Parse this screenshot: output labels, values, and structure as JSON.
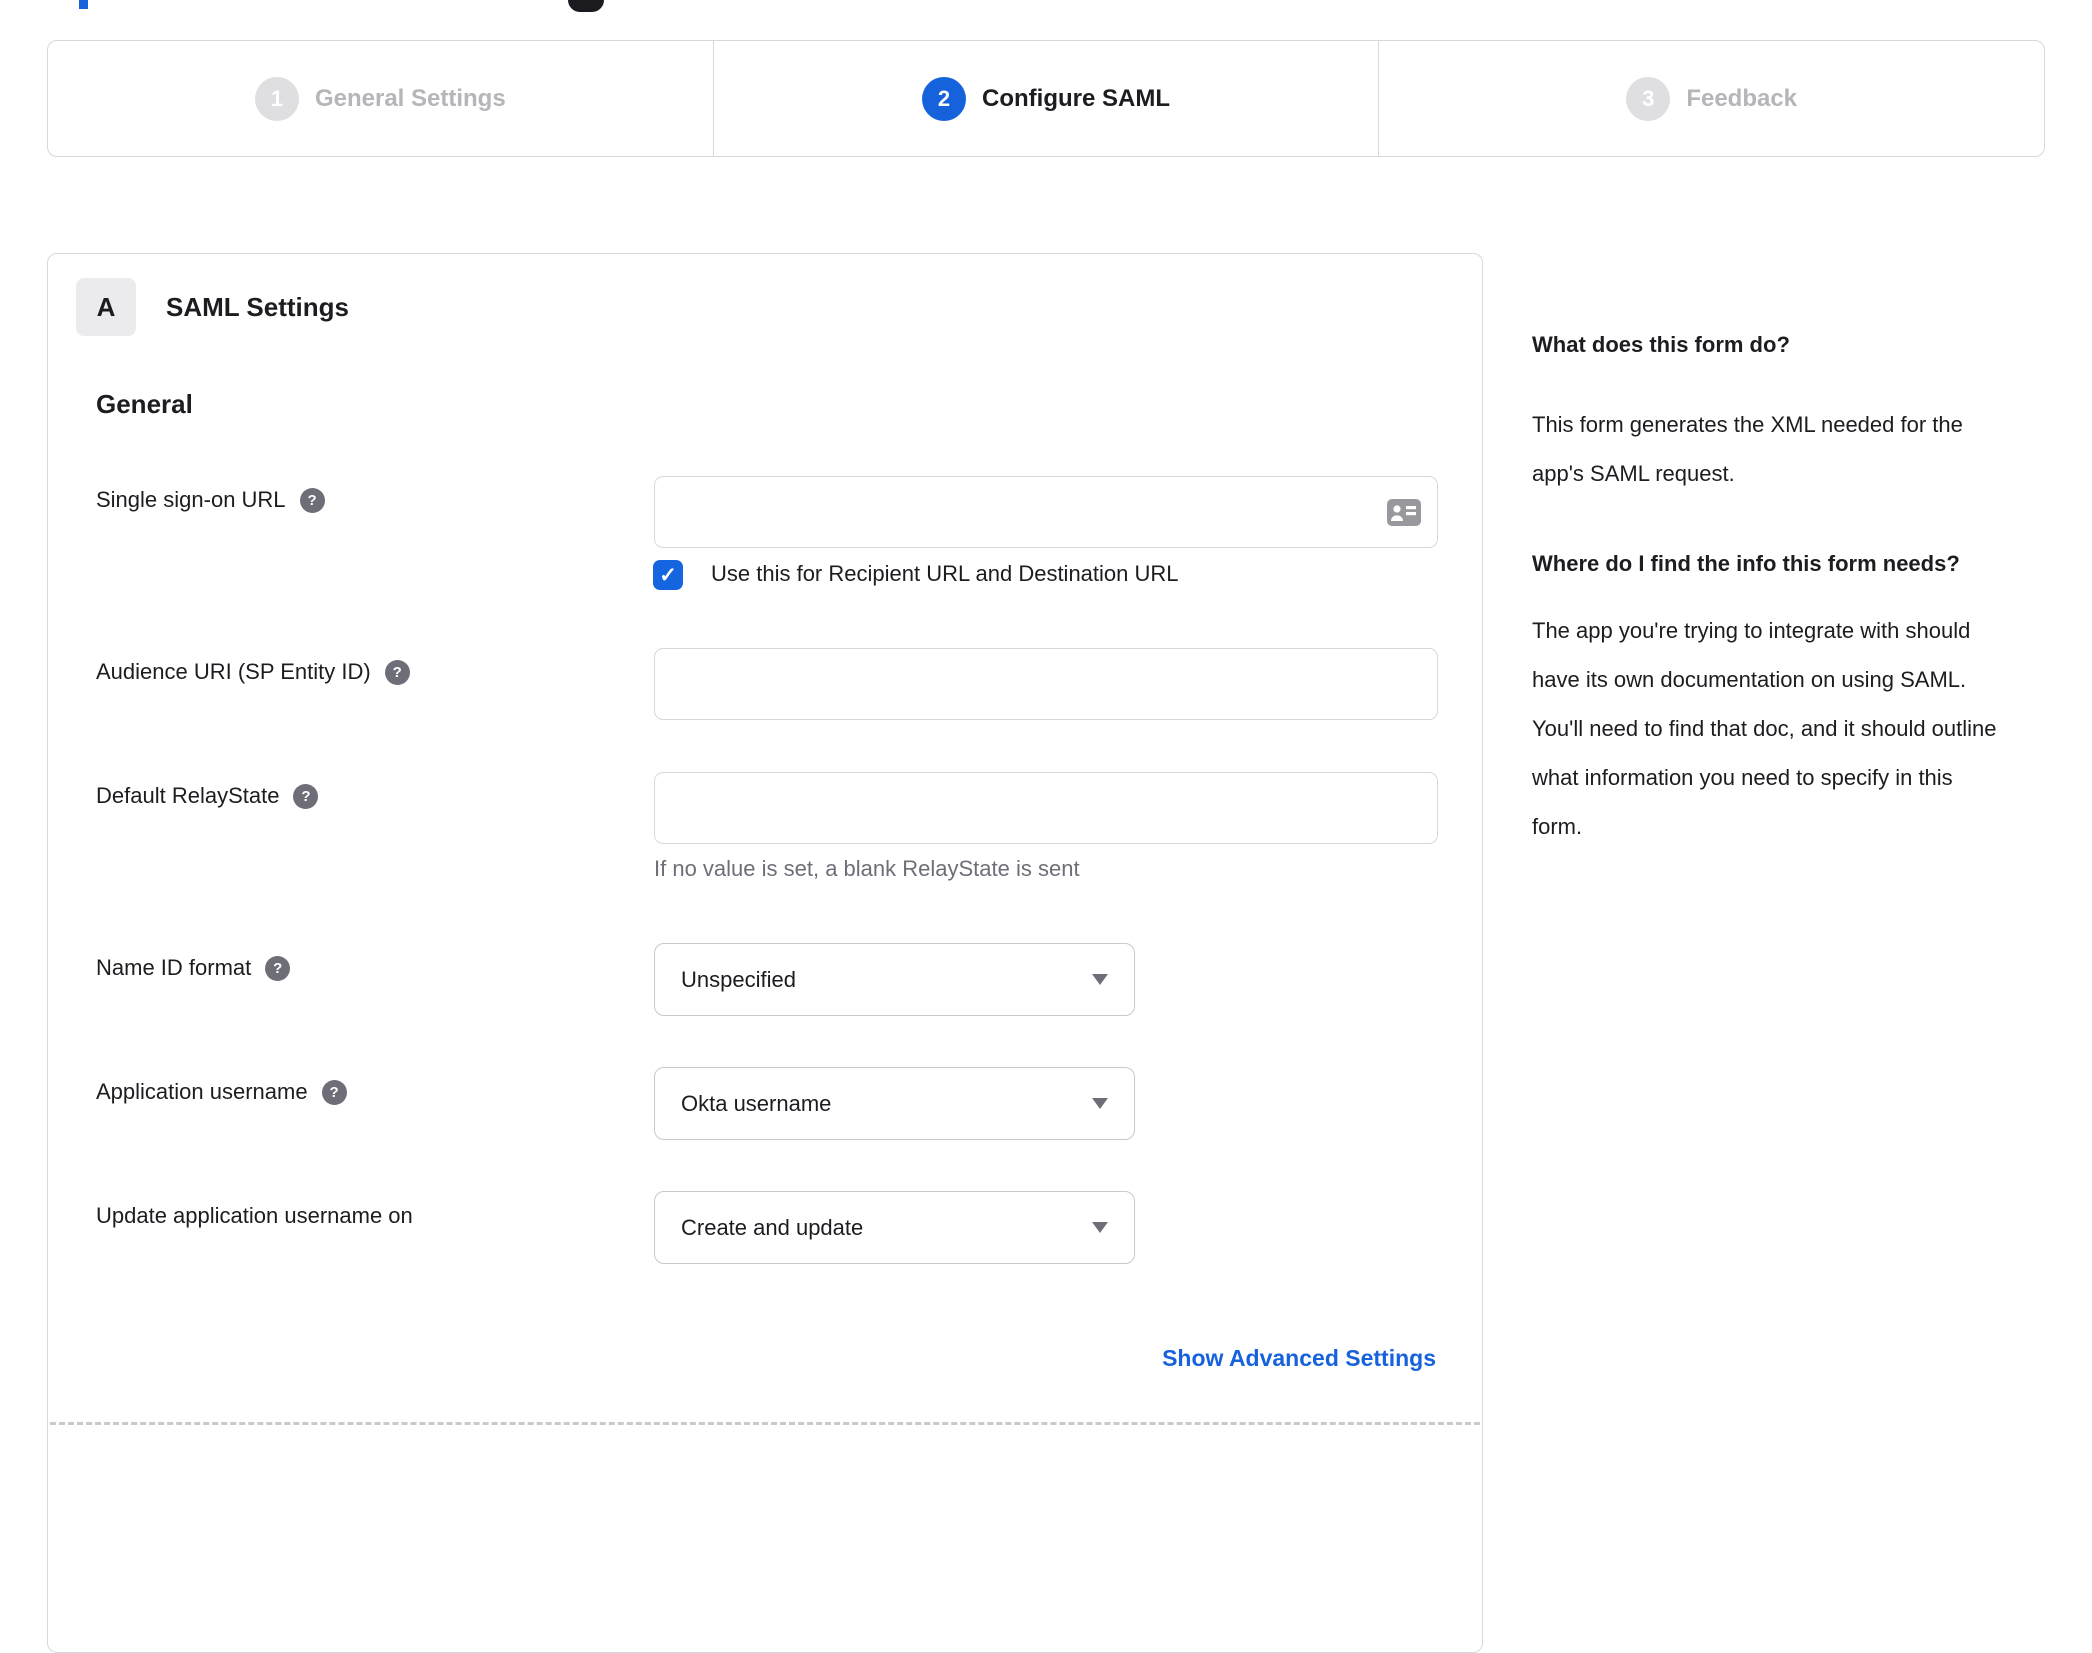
{
  "stepper": {
    "steps": [
      {
        "number": "1",
        "label": "General Settings",
        "state": "inactive"
      },
      {
        "number": "2",
        "label": "Configure SAML",
        "state": "active"
      },
      {
        "number": "3",
        "label": "Feedback",
        "state": "inactive"
      }
    ]
  },
  "panel": {
    "section_badge": "A",
    "section_title": "SAML Settings",
    "subsection_title": "General",
    "fields": {
      "sso": {
        "label": "Single sign-on URL",
        "value": "",
        "checkbox_label": "Use this for Recipient URL and Destination URL",
        "checkbox_checked": true
      },
      "audience": {
        "label": "Audience URI (SP Entity ID)",
        "value": ""
      },
      "relay": {
        "label": "Default RelayState",
        "value": "",
        "hint": "If no value is set, a blank RelayState is sent"
      },
      "name_id": {
        "label": "Name ID format",
        "value": "Unspecified"
      },
      "app_username": {
        "label": "Application username",
        "value": "Okta username"
      },
      "update_username": {
        "label": "Update application username on",
        "value": "Create and update"
      }
    },
    "advanced_link": "Show Advanced Settings"
  },
  "sidebar": {
    "sections": [
      {
        "heading": "What does this form do?",
        "body": "This form generates the XML needed for the app's SAML request."
      },
      {
        "heading": "Where do I find the info this form needs?",
        "body": "The app you're trying to integrate with should have its own documentation on using SAML. You'll need to find that doc, and it should outline what information you need to specify in this form."
      }
    ]
  },
  "icons": {
    "help": "?",
    "check": "✓"
  },
  "colors": {
    "accent_blue": "#1662dd",
    "text_dark": "#1d1d21",
    "text_gray": "#6e6e78",
    "inactive_gray": "#b5b5ba",
    "border_gray": "#d8d8dc"
  }
}
